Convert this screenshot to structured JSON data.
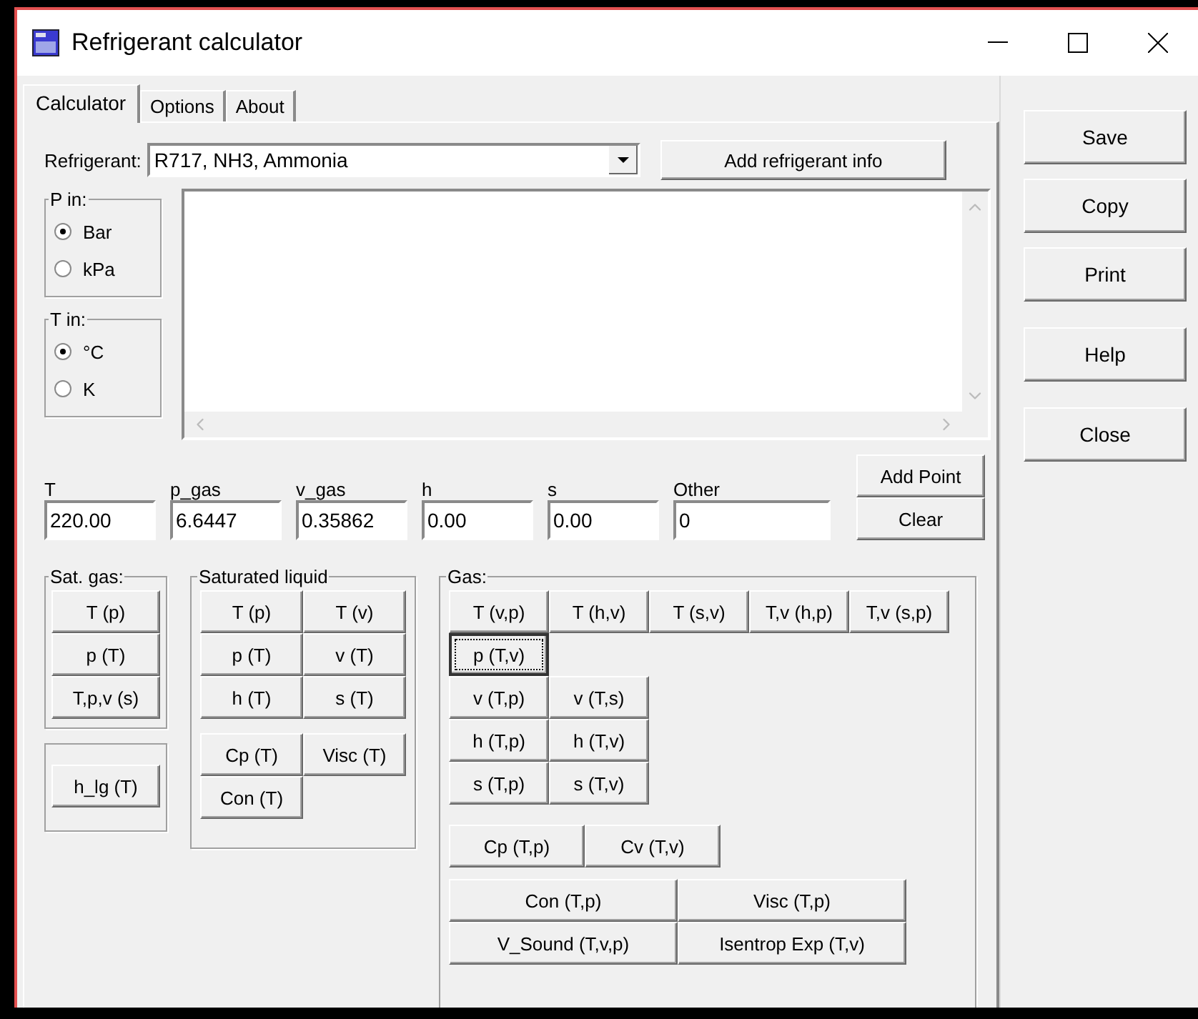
{
  "window": {
    "title": "Refrigerant calculator"
  },
  "tabs": [
    {
      "label": "Calculator",
      "selected": true
    },
    {
      "label": "Options",
      "selected": false
    },
    {
      "label": "About",
      "selected": false
    }
  ],
  "refrigerant": {
    "label": "Refrigerant:",
    "value": "R717, NH3, Ammonia"
  },
  "add_refrigerant_button": "Add refrigerant info",
  "unit_groups": [
    {
      "title": "P in:",
      "options": [
        {
          "label": "Bar",
          "selected": true
        },
        {
          "label": "kPa",
          "selected": false
        }
      ]
    },
    {
      "title": "T in:",
      "options": [
        {
          "label": "°C",
          "selected": true
        },
        {
          "label": "K",
          "selected": false
        }
      ]
    }
  ],
  "fields": [
    {
      "label": "T",
      "value": "220.00"
    },
    {
      "label": "p_gas",
      "value": "6.6447"
    },
    {
      "label": "v_gas",
      "value": "0.35862"
    },
    {
      "label": "h",
      "value": "0.00"
    },
    {
      "label": "s",
      "value": "0.00"
    },
    {
      "label": "Other",
      "value": "0"
    }
  ],
  "point_buttons": [
    "Add Point",
    "Clear"
  ],
  "sat_gas": {
    "title": "Sat. gas:",
    "buttons": [
      "T (p)",
      "p (T)",
      "T,p,v (s)"
    ]
  },
  "latent_button": "h_lg (T)",
  "saturated_liquid": {
    "title": "Saturated liquid",
    "blocks": [
      [
        [
          "T (p)",
          "T (v)"
        ],
        [
          "p (T)",
          "v (T)"
        ],
        [
          "h (T)",
          "s (T)"
        ]
      ],
      [
        [
          "Cp (T)",
          "Visc (T)"
        ],
        [
          "Con (T)"
        ]
      ]
    ]
  },
  "gas": {
    "title": "Gas:",
    "blocks": [
      {
        "kind": "narrow",
        "rows": [
          [
            {
              "label": "T (v,p)",
              "focused": false
            },
            {
              "label": "T (h,v)",
              "focused": false
            },
            {
              "label": "T (s,v)",
              "focused": false
            },
            {
              "label": "T,v (h,p)",
              "focused": false
            },
            {
              "label": "T,v (s,p)",
              "focused": false
            }
          ],
          [
            {
              "label": "p (T,v)",
              "focused": true
            }
          ],
          [
            {
              "label": "v (T,p)",
              "focused": false
            },
            {
              "label": "v (T,s)",
              "focused": false
            }
          ],
          [
            {
              "label": "h (T,p)",
              "focused": false
            },
            {
              "label": "h (T,v)",
              "focused": false
            }
          ],
          [
            {
              "label": "s (T,p)",
              "focused": false
            },
            {
              "label": "s (T,v)",
              "focused": false
            }
          ]
        ]
      },
      {
        "kind": "medium",
        "rows": [
          [
            {
              "label": "Cp (T,p)",
              "focused": false
            },
            {
              "label": "Cv (T,v)",
              "focused": false
            }
          ]
        ]
      },
      {
        "kind": "wide",
        "rows": [
          [
            {
              "label": "Con (T,p)",
              "focused": false
            },
            {
              "label": "Visc (T,p)",
              "focused": false
            }
          ],
          [
            {
              "label": "V_Sound (T,v,p)",
              "focused": false
            },
            {
              "label": "Isentrop Exp (T,v)",
              "focused": false
            }
          ]
        ]
      }
    ]
  },
  "side_buttons": [
    {
      "label": "Save",
      "kind": "top"
    },
    {
      "label": "Copy",
      "kind": "top"
    },
    {
      "label": "Print",
      "kind": "top"
    },
    {
      "label": "Help",
      "kind": "spaced"
    },
    {
      "label": "Close",
      "kind": "spaced"
    }
  ]
}
